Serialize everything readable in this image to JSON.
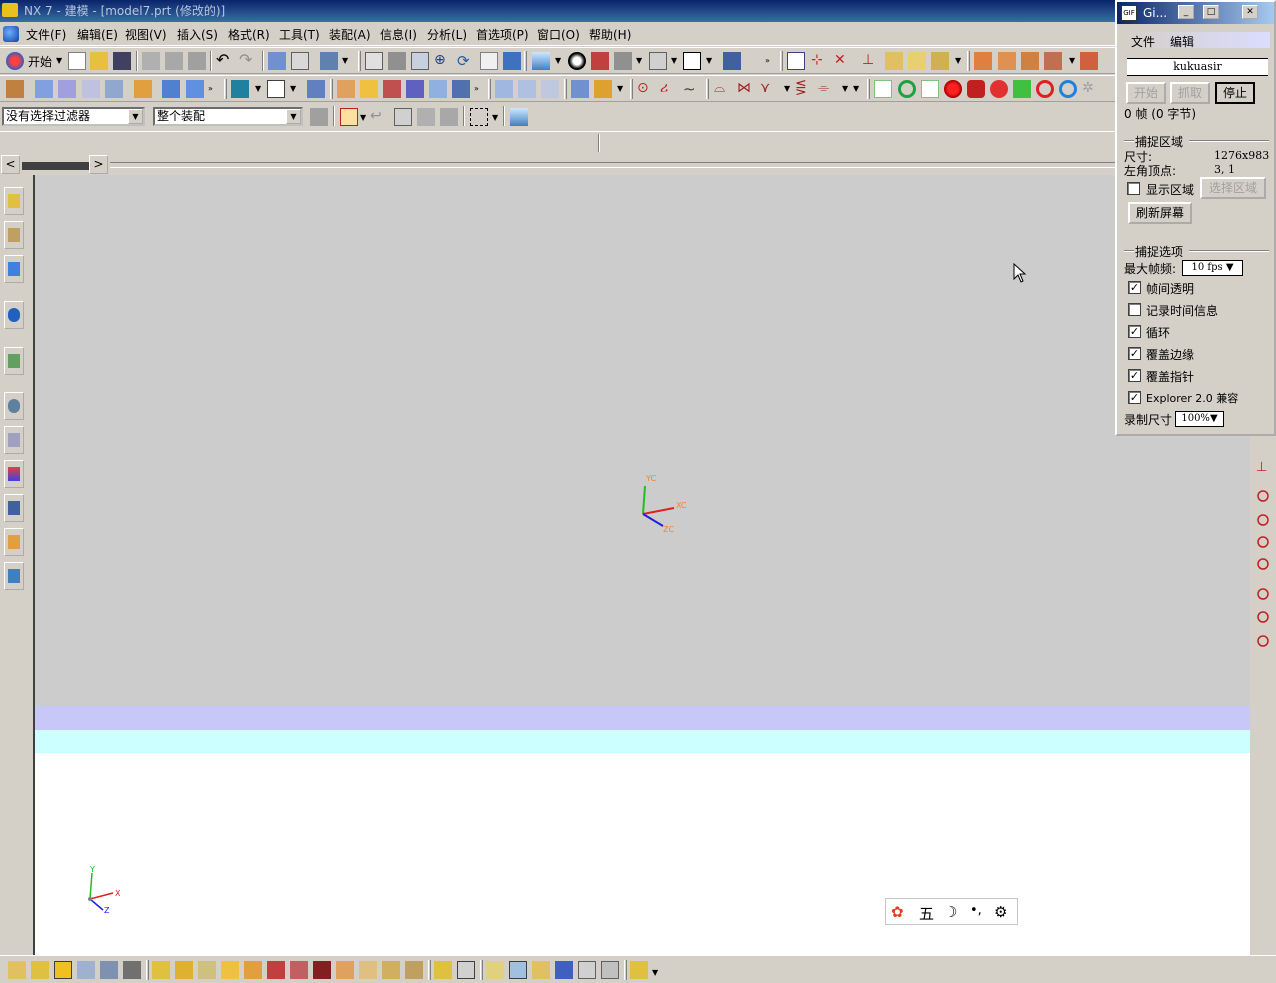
{
  "window": {
    "title": "NX 7 - 建模 - [model7.prt (修改的)]"
  },
  "menu": {
    "items": [
      "文件(F)",
      "编辑(E)",
      "视图(V)",
      "插入(S)",
      "格式(R)",
      "工具(T)",
      "装配(A)",
      "信息(I)",
      "分析(L)",
      "首选项(P)",
      "窗口(O)",
      "帮助(H)"
    ]
  },
  "toolbar": {
    "start_label": "开始"
  },
  "selection": {
    "filter_value": "没有选择过滤器",
    "scope_value": "整个装配"
  },
  "graphics": {
    "triad_main": {
      "xc": "XC",
      "yc": "YC",
      "zc": "ZC"
    },
    "triad_corner": {
      "x": "X",
      "y": "Y",
      "z": "Z"
    },
    "colors": {
      "background": "#cccccc",
      "band_lavender": "#c8c8f8",
      "band_cyan": "#ccffff",
      "lower": "#ffffff",
      "axis_x": "#e02020",
      "axis_y": "#20c020",
      "axis_z": "#2020e0",
      "axis_label": "#ff8020"
    }
  },
  "ime": {
    "mode": "五"
  },
  "capture": {
    "title": "Gi...",
    "menu_file": "文件",
    "menu_edit": "编辑",
    "name": "kukuasir",
    "btn_start": "开始",
    "btn_grab": "抓取",
    "btn_stop": "停止",
    "frames_info": "0 帧 (0 字节)",
    "region_heading": "捕捉区域",
    "size_label": "尺寸:",
    "size_value": "1276x983",
    "corner_label": "左角顶点:",
    "corner_value": "3, 1",
    "show_region": "显示区域",
    "select_region": "选择区域",
    "refresh": "刷新屏幕",
    "options_heading": "捕捉选项",
    "max_fps_label": "最大帧频:",
    "max_fps_value": "10 fps",
    "opt_transparent": "帧间透明",
    "opt_timeinfo": "记录时间信息",
    "opt_loop": "循环",
    "opt_border": "覆盖边缘",
    "opt_pointer": "覆盖指针",
    "opt_explorer": "Explorer 2.0 兼容",
    "rec_size_label": "录制尺寸",
    "rec_size_value": "100%",
    "checked": {
      "show_region": false,
      "transparent": true,
      "timeinfo": false,
      "loop": true,
      "border": true,
      "pointer": true,
      "explorer": true
    }
  }
}
